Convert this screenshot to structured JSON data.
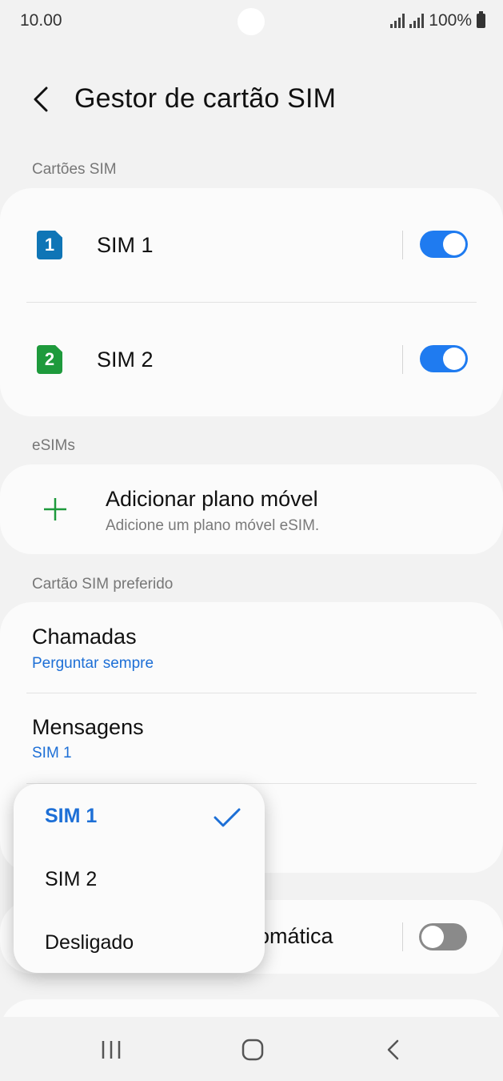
{
  "status_bar": {
    "time": "10.00",
    "battery": "100%"
  },
  "header": {
    "title": "Gestor de cartão SIM"
  },
  "sections": {
    "sim_cards": "Cartões SIM",
    "esims": "eSIMs",
    "preferred": "Cartão SIM preferido"
  },
  "sim_cards": [
    {
      "badge": "1",
      "label": "SIM 1",
      "enabled": true,
      "color": "#0f75b6"
    },
    {
      "badge": "2",
      "label": "SIM 2",
      "enabled": true,
      "color": "#1e9a3c"
    }
  ],
  "esim": {
    "title": "Adicionar plano móvel",
    "subtitle": "Adicione um plano móvel eSIM."
  },
  "preferred": {
    "calls": {
      "title": "Chamadas",
      "value": "Perguntar sempre"
    },
    "messages": {
      "title": "Mensagens",
      "value": "SIM 1"
    }
  },
  "auto_row": {
    "label_partial": "omática",
    "enabled": false
  },
  "popup": {
    "options": [
      "SIM 1",
      "SIM 2",
      "Desligado"
    ],
    "selected": "SIM 1"
  },
  "colors": {
    "accent": "#1f7bf0",
    "link": "#1d6fd6",
    "plus": "#1e9a3c"
  },
  "icons": [
    "back-icon",
    "sim-1-icon",
    "sim-2-icon",
    "plus-icon",
    "check-icon",
    "recents-icon",
    "home-icon",
    "nav-back-icon"
  ]
}
